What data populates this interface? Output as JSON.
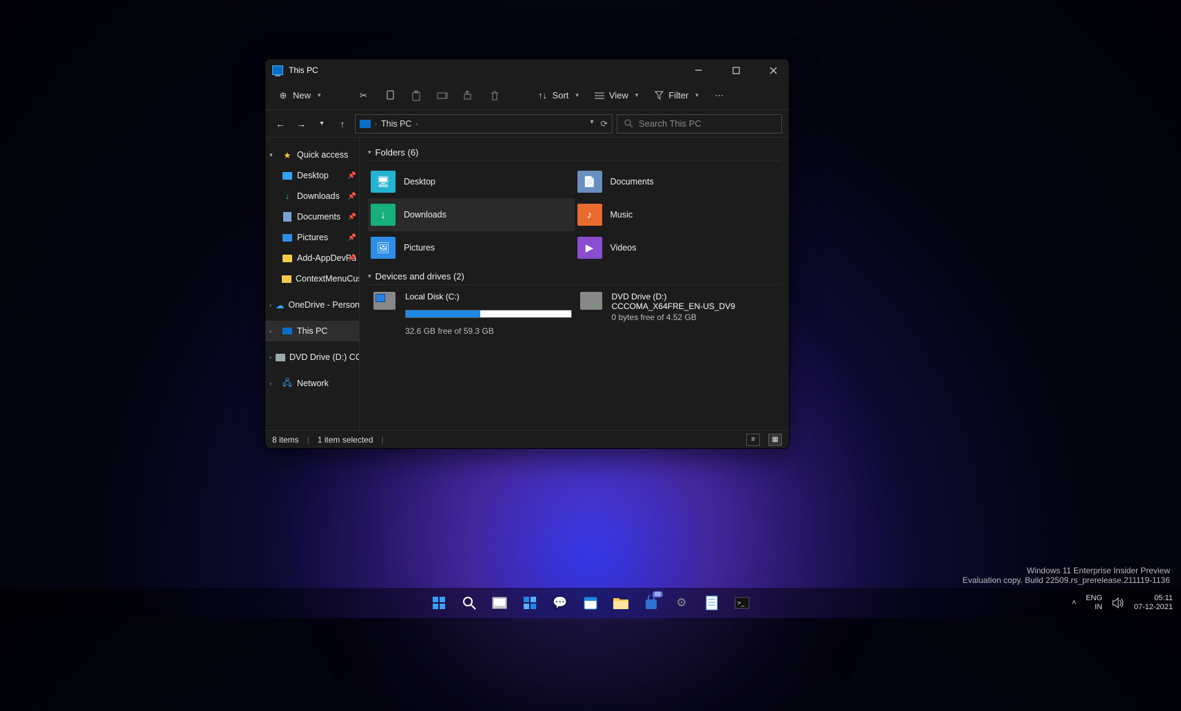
{
  "window": {
    "title": "This PC",
    "toolbar": {
      "new": "New",
      "sort": "Sort",
      "view": "View",
      "filter": "Filter"
    },
    "address": {
      "location": "This PC",
      "search_placeholder": "Search This PC"
    },
    "sidebar": {
      "quick_access": "Quick access",
      "items": {
        "desktop": "Desktop",
        "downloads": "Downloads",
        "documents": "Documents",
        "pictures": "Pictures",
        "add_app": "Add-AppDevPa",
        "context": "ContextMenuCust"
      },
      "onedrive": "OneDrive - Personal",
      "this_pc": "This PC",
      "dvd": "DVD Drive (D:) CCCO",
      "network": "Network"
    },
    "sections": {
      "folders": "Folders (6)",
      "devices": "Devices and drives (2)"
    },
    "folders": {
      "desktop": "Desktop",
      "documents": "Documents",
      "downloads": "Downloads",
      "music": "Music",
      "pictures": "Pictures",
      "videos": "Videos"
    },
    "drives": {
      "c": {
        "name": "Local Disk (C:)",
        "sub": "32.6 GB free of 59.3 GB",
        "used_percent": 45
      },
      "d": {
        "name": "DVD Drive (D:)",
        "label": "CCCOMA_X64FRE_EN-US_DV9",
        "sub": "0 bytes free of 4.52 GB"
      }
    },
    "status": {
      "items": "8 items",
      "selected": "1 item selected"
    }
  },
  "watermark": {
    "line1": "Windows 11 Enterprise Insider Preview",
    "line2": "Evaluation copy. Build 22509.rs_prerelease.211119-1136"
  },
  "tray": {
    "lang1": "ENG",
    "lang2": "IN",
    "time": "05:11",
    "date": "07-12-2021"
  },
  "taskbar": {
    "badge": "89"
  }
}
